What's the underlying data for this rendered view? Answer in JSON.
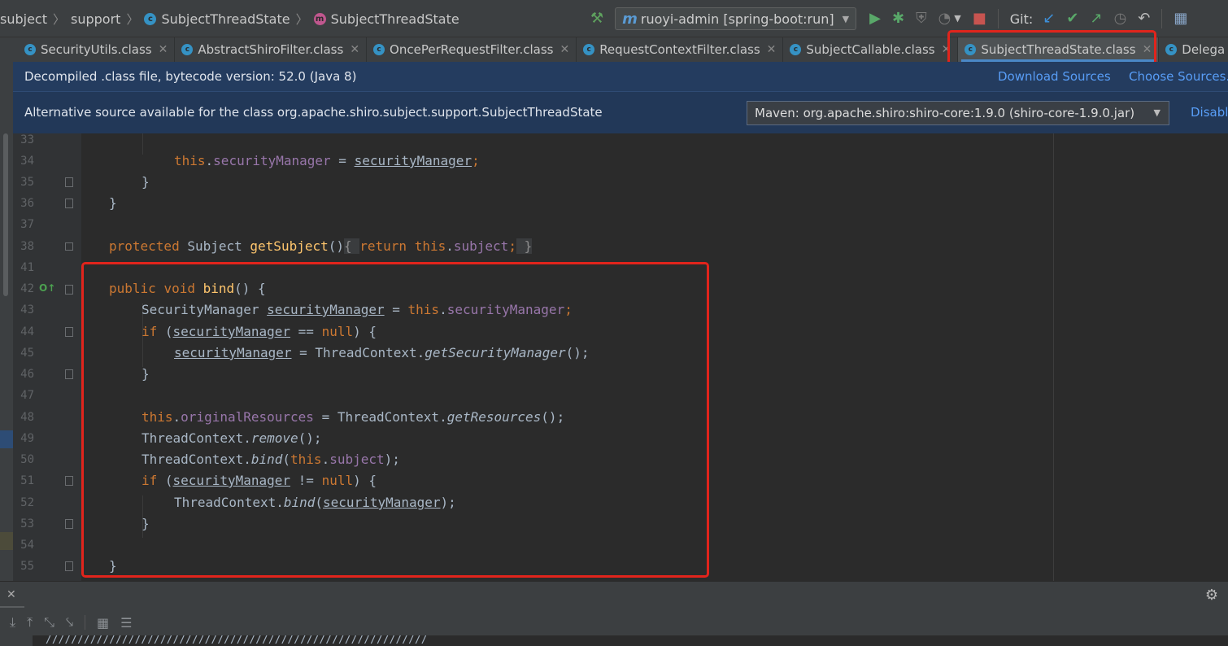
{
  "breadcrumbs": [
    {
      "label": "subject",
      "icon": "none"
    },
    {
      "label": "support",
      "icon": "none"
    },
    {
      "label": "SubjectThreadState",
      "icon": "class-icon"
    },
    {
      "label": "SubjectThreadState",
      "icon": "method-icon"
    }
  ],
  "toolbar": {
    "run_config": "ruoyi-admin [spring-boot:run]",
    "git_label": "Git:"
  },
  "tabs": [
    {
      "label": "SecurityUtils.class",
      "active": false
    },
    {
      "label": "AbstractShiroFilter.class",
      "active": false
    },
    {
      "label": "OncePerRequestFilter.class",
      "active": false
    },
    {
      "label": "RequestContextFilter.class",
      "active": false
    },
    {
      "label": "SubjectCallable.class",
      "active": false
    },
    {
      "label": "SubjectThreadState.class",
      "active": true
    },
    {
      "label": "Delega",
      "active": false
    }
  ],
  "banner_decompiled": {
    "text": "Decompiled .class file, bytecode version: 52.0 (Java 8)",
    "download_sources": "Download Sources",
    "choose_sources": "Choose Sources..."
  },
  "banner_alternative": {
    "text": "Alternative source available for the class org.apache.shiro.subject.support.SubjectThreadState",
    "select_value": "Maven: org.apache.shiro:shiro-core:1.9.0 (shiro-core-1.9.0.jar)",
    "disable": "Disable"
  },
  "line_numbers": [
    "33",
    "34",
    "35",
    "36",
    "37",
    "38",
    "41",
    "42",
    "43",
    "44",
    "45",
    "46",
    "47",
    "48",
    "49",
    "50",
    "51",
    "52",
    "53",
    "54",
    "55"
  ],
  "code": {
    "l34": {
      "this": "this",
      "dot": ".",
      "field": "securityManager",
      "eq": " = ",
      "var": "securityManager",
      "semi": ";"
    },
    "l35": "}",
    "l36": "}",
    "l38": {
      "protected": "protected",
      "type": " Subject ",
      "name": "getSubject",
      "parens": "()",
      "open": "{ ",
      "return": "return",
      "sp": " ",
      "this": "this",
      "dot": ".",
      "field": "subject",
      "semi": ";",
      "close": " }"
    },
    "l42": {
      "public": "public",
      "void": "void",
      "name": "bind",
      "rest": "() {"
    },
    "l43": {
      "type": "SecurityManager ",
      "var": "securityManager",
      "eq": " = ",
      "this": "this",
      "dot": ".",
      "field": "securityManager",
      "semi": ";"
    },
    "l44": {
      "if": "if",
      "open": " (",
      "var": "securityManager",
      "op": " == ",
      "null": "null",
      "close": ") {"
    },
    "l45": {
      "var": "securityManager",
      "eq": " = ThreadContext.",
      "call": "getSecurityManager",
      "end": "();"
    },
    "l46": "}",
    "l48": {
      "this": "this",
      "dot": ".",
      "field": "originalResources",
      "eq": " = ThreadContext.",
      "call": "getResources",
      "end": "();"
    },
    "l49": {
      "cls": "ThreadContext.",
      "call": "remove",
      "end": "();"
    },
    "l50": {
      "cls": "ThreadContext.",
      "call": "bind",
      "open": "(",
      "this": "this",
      "dot": ".",
      "field": "subject",
      "end": ");"
    },
    "l51": {
      "if": "if",
      "open": " (",
      "var": "securityManager",
      "op": " != ",
      "null": "null",
      "close": ") {"
    },
    "l52": {
      "cls": "ThreadContext.",
      "call": "bind",
      "open": "(",
      "var": "securityManager",
      "end": ");"
    },
    "l53": "}",
    "l55": "}"
  },
  "override_marker": "O↑",
  "console_text": "////////////////////////////////////////////////////////////",
  "colors": {
    "highlight_box": "#e1241c",
    "keyword": "#cc7832",
    "field": "#9876aa",
    "method": "#ffc66d",
    "text": "#a9b7c6",
    "banner_bg": "#243c5f",
    "link": "#589df6"
  }
}
